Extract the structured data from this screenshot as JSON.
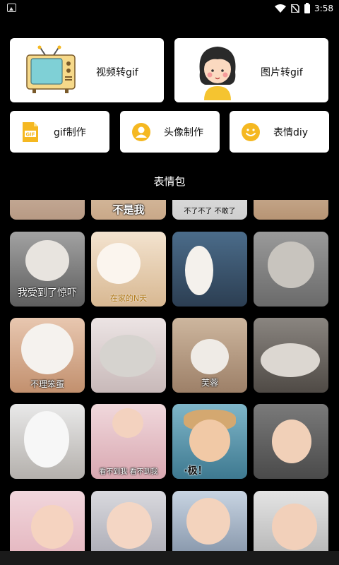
{
  "status": {
    "time": "3:58"
  },
  "features": {
    "video_to_gif": "视频转gif",
    "image_to_gif": "图片转gif",
    "gif_make": "gif制作",
    "avatar_make": "头像制作",
    "emoji_diy": "表情diy"
  },
  "section": {
    "title": "表情包"
  },
  "stickers": {
    "row0": [
      "",
      "不是我",
      "不了不了  不敢了",
      ""
    ],
    "row1": [
      "我受到了惊吓",
      "在家的N天",
      "",
      ""
    ],
    "row2": [
      "不理笨蛋",
      "",
      "芙蓉",
      ""
    ],
    "row3": [
      "",
      "看不到我 看不到我",
      "·极！",
      ""
    ],
    "row4": [
      "",
      "",
      "",
      ""
    ]
  },
  "colors": {
    "accent": "#f5b821",
    "background": "#000000",
    "card": "#ffffff"
  }
}
